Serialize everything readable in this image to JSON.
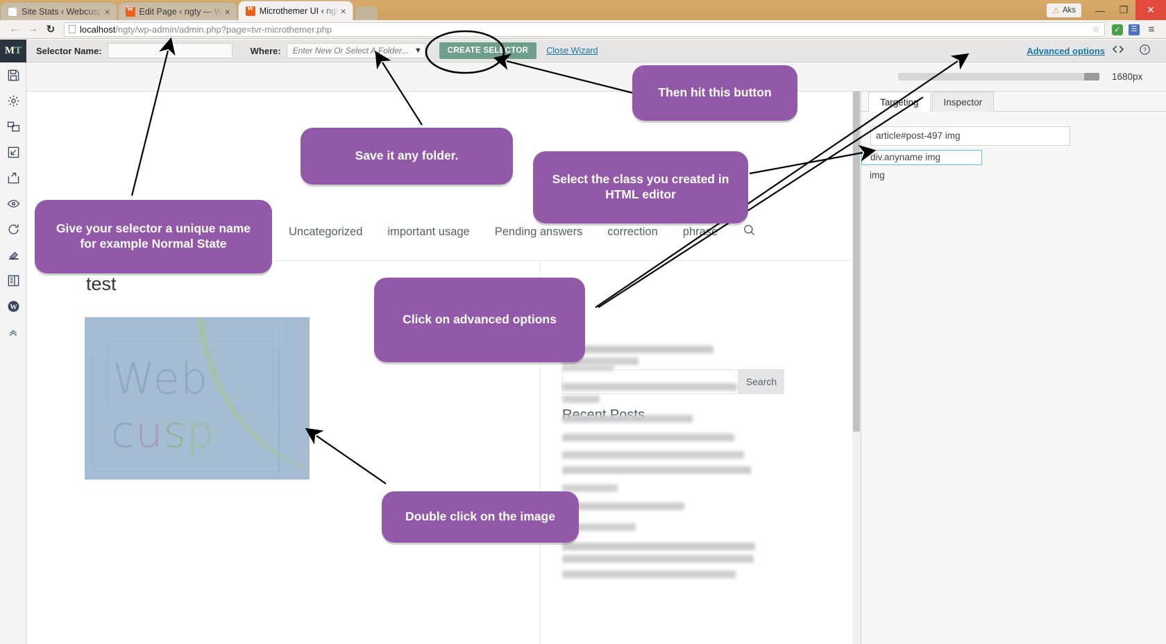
{
  "browser": {
    "tabs": [
      {
        "title": "Site Stats ‹ Webcusp",
        "favicon": "page-icon",
        "active": false
      },
      {
        "title": "Edit Page ‹ ngty — W",
        "favicon": "wordpress-icon",
        "active": false
      },
      {
        "title": "Microthemer UI ‹ ngt",
        "favicon": "wordpress-icon",
        "active": true
      }
    ],
    "close_label": "×",
    "url_host": "localhost",
    "url_path": "/ngty/wp-admin/admin.php?page=tvr-microthemer.php",
    "warning_label": "Aks",
    "warning_icon": "warning-triangle-icon",
    "window_minimize": "—",
    "window_maximize": "❐",
    "window_close": "✕",
    "back_icon": "arrow-left-icon",
    "forward_icon": "arrow-right-icon",
    "reload_icon": "reload-icon",
    "bookmark_icon": "star-icon",
    "menu_icon": "hamburger-icon"
  },
  "sidebar": {
    "logo_m": "M",
    "logo_t": "T",
    "items": [
      {
        "name": "save-icon",
        "label": "Save"
      },
      {
        "name": "settings-icon",
        "label": "Preferences"
      },
      {
        "name": "responsive-icon",
        "label": "Responsive Views"
      },
      {
        "name": "import-icon",
        "label": "Import"
      },
      {
        "name": "export-icon",
        "label": "Export"
      },
      {
        "name": "preview-eye-icon",
        "label": "Preview"
      },
      {
        "name": "revert-icon",
        "label": "Revert"
      },
      {
        "name": "eraser-icon",
        "label": "Clear Styles"
      },
      {
        "name": "layout-icon",
        "label": "Page Layout"
      },
      {
        "name": "wordpress-icon",
        "label": "WordPress"
      },
      {
        "name": "collapse-icon",
        "label": "Collapse"
      }
    ]
  },
  "toolbar": {
    "selector_name_label": "Selector Name:",
    "selector_name_value": "",
    "selector_name_placeholder": "",
    "where_label": "Where:",
    "folder_placeholder": "Enter New Or Select A Folder...",
    "folder_value": "",
    "dropdown_icon": "chevron-down-icon",
    "create_selector_label": "CREATE SELECTOR",
    "close_wizard_label": "Close Wizard",
    "advanced_options_label": "Advanced options",
    "code_icon": "code-brackets-icon",
    "help_icon": "question-circle-icon",
    "accent_green": "#6f9f8a",
    "link_blue": "#1a76a8"
  },
  "widthbar": {
    "width_label": "1680px",
    "slider_position_percent": 100
  },
  "preview": {
    "nav_items": [
      "Uncategorized",
      "important usage",
      "Pending answers",
      "correction",
      "phrase"
    ],
    "search_icon": "magnifier-icon",
    "post_title": "test",
    "image_alt": "Webcusp logo",
    "image_text_top": "Web",
    "image_text_bottom": "cusp",
    "search_placeholder": "",
    "search_button_label": "Search",
    "recent_posts_heading": "Recent Posts"
  },
  "right_panel": {
    "tabs": [
      {
        "label": "Targeting",
        "active": true
      },
      {
        "label": "Inspector",
        "active": false
      }
    ],
    "selector_value": "article#post-497 img",
    "candidates": [
      {
        "text": "div.anyname img",
        "selected": true
      },
      {
        "text": "img",
        "selected": false
      }
    ],
    "highlight_color": "#5cc6dd"
  },
  "annotations": {
    "accent_purple": "#9159a8",
    "callouts": [
      {
        "id": "then-hit-this-button",
        "text": "Then hit this button"
      },
      {
        "id": "save-it-any-folder",
        "text": "Save it any folder."
      },
      {
        "id": "select-the-class",
        "text": "Select the class you created in HTML editor"
      },
      {
        "id": "give-selector-name",
        "text": "Give your selector a unique name for example Normal State"
      },
      {
        "id": "click-advanced",
        "text": "Click on advanced options"
      },
      {
        "id": "double-click-image",
        "text": "Double click on the image"
      }
    ]
  }
}
